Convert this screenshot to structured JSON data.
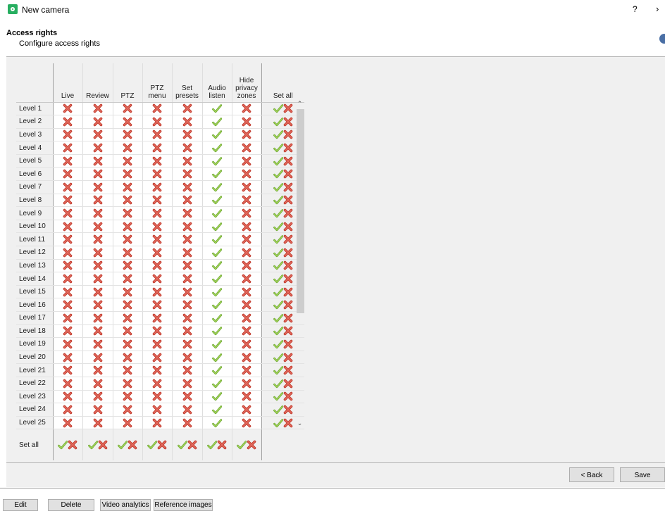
{
  "window": {
    "title": "New camera",
    "help": "?",
    "close": "›"
  },
  "section": {
    "title": "Access rights",
    "subtitle": "Configure access rights"
  },
  "columns": [
    {
      "id": "c-live",
      "label": "Live"
    },
    {
      "id": "c-review",
      "label": "Review"
    },
    {
      "id": "c-ptz",
      "label": "PTZ"
    },
    {
      "id": "c-ptzm",
      "label": "PTZ\nmenu"
    },
    {
      "id": "c-setp",
      "label": "Set\npresets"
    },
    {
      "id": "c-audio",
      "label": "Audio\nlisten"
    },
    {
      "id": "c-hide",
      "label": "Hide\nprivacy\nzones"
    }
  ],
  "set_all_label": "Set all",
  "rows": [
    {
      "label": "Level 1",
      "perms": [
        false,
        false,
        false,
        false,
        false,
        true,
        false
      ]
    },
    {
      "label": "Level 2",
      "perms": [
        false,
        false,
        false,
        false,
        false,
        true,
        false
      ]
    },
    {
      "label": "Level 3",
      "perms": [
        false,
        false,
        false,
        false,
        false,
        true,
        false
      ]
    },
    {
      "label": "Level 4",
      "perms": [
        false,
        false,
        false,
        false,
        false,
        true,
        false
      ]
    },
    {
      "label": "Level 5",
      "perms": [
        false,
        false,
        false,
        false,
        false,
        true,
        false
      ]
    },
    {
      "label": "Level 6",
      "perms": [
        false,
        false,
        false,
        false,
        false,
        true,
        false
      ]
    },
    {
      "label": "Level 7",
      "perms": [
        false,
        false,
        false,
        false,
        false,
        true,
        false
      ]
    },
    {
      "label": "Level 8",
      "perms": [
        false,
        false,
        false,
        false,
        false,
        true,
        false
      ]
    },
    {
      "label": "Level 9",
      "perms": [
        false,
        false,
        false,
        false,
        false,
        true,
        false
      ]
    },
    {
      "label": "Level 10",
      "perms": [
        false,
        false,
        false,
        false,
        false,
        true,
        false
      ]
    },
    {
      "label": "Level 11",
      "perms": [
        false,
        false,
        false,
        false,
        false,
        true,
        false
      ]
    },
    {
      "label": "Level 12",
      "perms": [
        false,
        false,
        false,
        false,
        false,
        true,
        false
      ]
    },
    {
      "label": "Level 13",
      "perms": [
        false,
        false,
        false,
        false,
        false,
        true,
        false
      ]
    },
    {
      "label": "Level 14",
      "perms": [
        false,
        false,
        false,
        false,
        false,
        true,
        false
      ]
    },
    {
      "label": "Level 15",
      "perms": [
        false,
        false,
        false,
        false,
        false,
        true,
        false
      ]
    },
    {
      "label": "Level 16",
      "perms": [
        false,
        false,
        false,
        false,
        false,
        true,
        false
      ]
    },
    {
      "label": "Level 17",
      "perms": [
        false,
        false,
        false,
        false,
        false,
        true,
        false
      ]
    },
    {
      "label": "Level 18",
      "perms": [
        false,
        false,
        false,
        false,
        false,
        true,
        false
      ]
    },
    {
      "label": "Level 19",
      "perms": [
        false,
        false,
        false,
        false,
        false,
        true,
        false
      ]
    },
    {
      "label": "Level 20",
      "perms": [
        false,
        false,
        false,
        false,
        false,
        true,
        false
      ]
    },
    {
      "label": "Level 21",
      "perms": [
        false,
        false,
        false,
        false,
        false,
        true,
        false
      ]
    },
    {
      "label": "Level 22",
      "perms": [
        false,
        false,
        false,
        false,
        false,
        true,
        false
      ]
    },
    {
      "label": "Level 23",
      "perms": [
        false,
        false,
        false,
        false,
        false,
        true,
        false
      ]
    },
    {
      "label": "Level 24",
      "perms": [
        false,
        false,
        false,
        false,
        false,
        true,
        false
      ]
    },
    {
      "label": "Level 25",
      "perms": [
        false,
        false,
        false,
        false,
        false,
        true,
        false
      ]
    }
  ],
  "footer_buttons": {
    "back": "< Back",
    "save": "Save"
  },
  "toolbar": {
    "edit": "Edit",
    "delete": "Delete",
    "video_analytics": "Video analytics",
    "reference_images": "Reference images"
  },
  "icons": {
    "allowed": "check-icon",
    "denied": "cross-icon",
    "check_color": "#8dc63f",
    "cross_color": "#d9534f"
  }
}
